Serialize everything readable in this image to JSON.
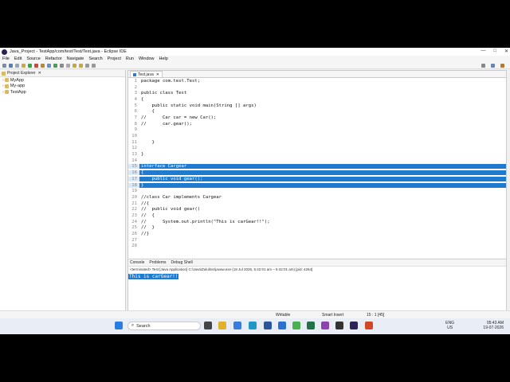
{
  "window": {
    "title": "Java_Project - TestApp/com/test/Test/Test.java - Eclipse IDE",
    "controls": [
      "—",
      "□",
      "✕"
    ]
  },
  "menu": [
    "File",
    "Edit",
    "Source",
    "Refactor",
    "Navigate",
    "Search",
    "Project",
    "Run",
    "Window",
    "Help"
  ],
  "explorer": {
    "tab_label": "Project Explorer",
    "items": [
      "MyApp",
      "My-app",
      "TestApp"
    ]
  },
  "editor": {
    "tab_label": "Test.java",
    "lines": [
      {
        "n": "1",
        "t": "package com.test.Test;"
      },
      {
        "n": "2",
        "t": ""
      },
      {
        "n": "3",
        "t": "public class Test"
      },
      {
        "n": "4",
        "t": "{"
      },
      {
        "n": "5",
        "t": "    public static void main(String [] args)"
      },
      {
        "n": "6",
        "t": "    {"
      },
      {
        "n": "7",
        "t": "//      Car car = new Car();"
      },
      {
        "n": "8",
        "t": "//      car.gear();"
      },
      {
        "n": "9",
        "t": ""
      },
      {
        "n": "10",
        "t": ""
      },
      {
        "n": "11",
        "t": "    }"
      },
      {
        "n": "12",
        "t": ""
      },
      {
        "n": "13",
        "t": "}"
      },
      {
        "n": "14",
        "t": ""
      },
      {
        "n": "15",
        "t": "interface Cargear",
        "sel": true
      },
      {
        "n": "16",
        "t": "{",
        "sel": true
      },
      {
        "n": "17",
        "t": "    public void gear();",
        "sel": true
      },
      {
        "n": "18",
        "t": "}",
        "sel": true
      },
      {
        "n": "19",
        "t": ""
      },
      {
        "n": "20",
        "t": "//class Car implements Cargear"
      },
      {
        "n": "21",
        "t": "//{"
      },
      {
        "n": "22",
        "t": "//  public void gear()"
      },
      {
        "n": "23",
        "t": "//  {"
      },
      {
        "n": "24",
        "t": "//      System.out.println(\"This is carGear!!\");"
      },
      {
        "n": "25",
        "t": "//  }"
      },
      {
        "n": "26",
        "t": "//}"
      },
      {
        "n": "27",
        "t": ""
      },
      {
        "n": "28",
        "t": ""
      }
    ]
  },
  "console": {
    "tabs": [
      "Console",
      "Problems",
      "Debug Shell"
    ],
    "info": "<terminated> Test [Java Application] C:\\Java\\Zulu\\bin\\javaw.exe  (19 Jul 2026, 5:42:01 am – 5:42:01 am) [pid: 4264]",
    "output": "This is carGear!!"
  },
  "status": {
    "mode": "Writable",
    "insert": "Smart Insert",
    "position": "15 : 1 [45]"
  },
  "taskbar": {
    "search": "Search",
    "lang_top": "ENG",
    "lang_bottom": "US",
    "time": "05:43 AM",
    "date": "19-07-2026"
  }
}
